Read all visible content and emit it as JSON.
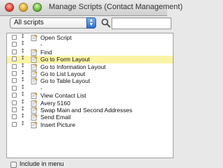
{
  "window": {
    "title": "Manage Scripts (Contact Management)"
  },
  "filter": {
    "selected": "All scripts"
  },
  "search": {
    "placeholder": ""
  },
  "scripts": [
    {
      "label": "Open Script",
      "selected": false
    },
    {
      "label": "-",
      "selected": false
    },
    {
      "label": "Find",
      "selected": false
    },
    {
      "label": "Go to Form Layout",
      "selected": true
    },
    {
      "label": "Go to Information Layout",
      "selected": false
    },
    {
      "label": "Go to List Layout",
      "selected": false
    },
    {
      "label": "Go to Table Layout",
      "selected": false
    },
    {
      "label": "-",
      "selected": false
    },
    {
      "label": "View Contact List",
      "selected": false
    },
    {
      "label": "Avery 5160",
      "selected": false
    },
    {
      "label": "Swap Main and Second Addresses",
      "selected": false
    },
    {
      "label": "Send Email",
      "selected": false
    },
    {
      "label": "Insert Picture",
      "selected": false
    }
  ],
  "bottom": {
    "include_in_menu_label": "Include in menu"
  },
  "colors": {
    "selection_highlight": "#fbf3a6",
    "accent_blue": "#2d6fd2"
  }
}
